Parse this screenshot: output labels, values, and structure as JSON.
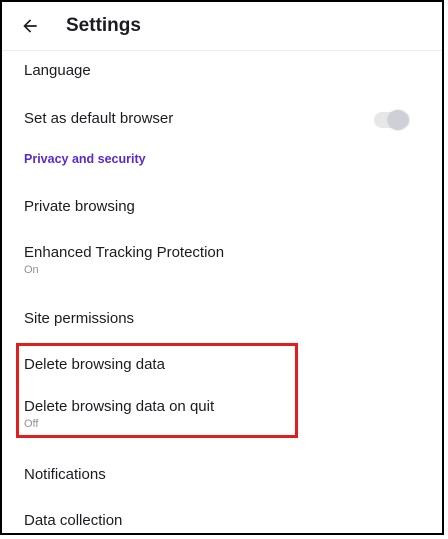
{
  "header": {
    "title": "Settings"
  },
  "settings": {
    "language": "Language",
    "default_browser": "Set as default browser",
    "privacy_section": "Privacy and security",
    "private_browsing": "Private browsing",
    "etp_label": "Enhanced Tracking Protection",
    "etp_status": "On",
    "site_permissions": "Site permissions",
    "delete_data": "Delete browsing data",
    "delete_on_quit": "Delete browsing data on quit",
    "delete_on_quit_status": "Off",
    "notifications": "Notifications",
    "data_collection": "Data collection"
  },
  "state": {
    "default_browser_toggle": "off"
  },
  "colors": {
    "accent": "#592acb",
    "highlight": "#e11d1d"
  }
}
